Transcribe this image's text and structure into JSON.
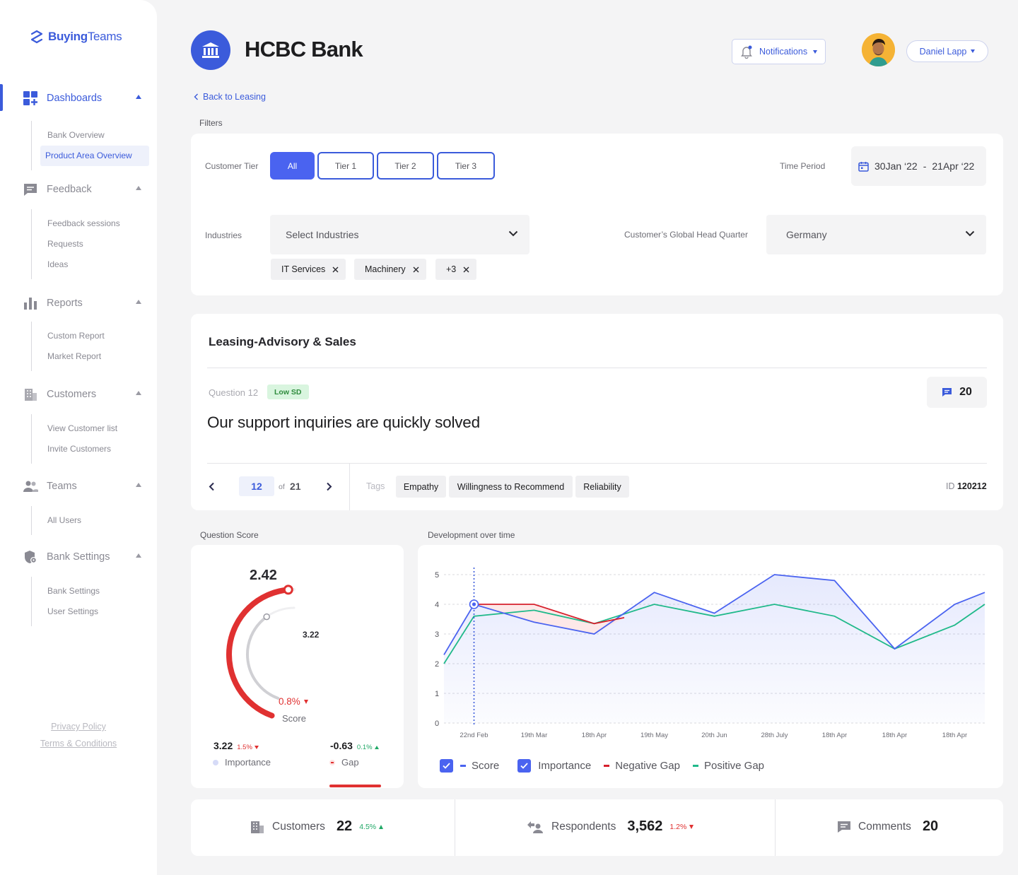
{
  "app": {
    "logo_bold": "Buying",
    "logo_light": "Teams"
  },
  "sidebar": {
    "groups": [
      {
        "label": "Dashboards",
        "icon": "dashboard-icon",
        "items": [
          "Bank Overview",
          "Product Area Overview"
        ],
        "selected": "Product Area Overview",
        "active": true
      },
      {
        "label": "Feedback",
        "icon": "feedback-icon",
        "items": [
          "Feedback sessions",
          "Requests",
          "Ideas"
        ]
      },
      {
        "label": "Reports",
        "icon": "bar-chart-icon",
        "items": [
          "Custom Report",
          "Market Report"
        ]
      },
      {
        "label": "Customers",
        "icon": "building-icon",
        "items": [
          "View Customer list",
          "Invite Customers"
        ]
      },
      {
        "label": "Teams",
        "icon": "people-icon",
        "items": [
          "All Users"
        ]
      },
      {
        "label": "Bank Settings",
        "icon": "shield-icon",
        "items": [
          "Bank Settings",
          "User Settings"
        ]
      }
    ],
    "footer": {
      "privacy": "Privacy Policy",
      "terms": "Terms & Conditions"
    }
  },
  "header": {
    "bank_name": "HCBC Bank",
    "notifications": "Notifications",
    "user": "Daniel Lapp"
  },
  "back_link": "Back to Leasing",
  "filters": {
    "section_label": "Filters",
    "customer_tier_label": "Customer Tier",
    "tiers": [
      "All",
      "Tier 1",
      "Tier 2",
      "Tier 3"
    ],
    "selected_tier": "All",
    "time_period_label": "Time Period",
    "time_start": "30Jan ‘22",
    "time_sep": "-",
    "time_end": "21Apr ‘22",
    "industries_label": "Industries",
    "industries_placeholder": "Select Industries",
    "industry_chips": [
      "IT Services",
      "Machinery",
      "+3"
    ],
    "hq_label": "Customer’s Global Head Quarter",
    "hq_value": "Germany"
  },
  "question_card": {
    "title": "Leasing-Advisory & Sales",
    "question_number": "Question 12",
    "badge": "Low SD",
    "question": "Our support inquiries are quickly solved",
    "comments": "20",
    "page_current": "12",
    "page_of": "of",
    "page_total": "21",
    "tags_label": "Tags",
    "tags": [
      "Empathy",
      "Willingness to Recommend",
      "Reliability"
    ],
    "id_label": "ID",
    "id_value": "120212"
  },
  "score_card": {
    "section_label": "Question Score",
    "score": "2.42",
    "inner": "3.22",
    "score_change": "0.8%",
    "score_label": "Score",
    "importance_value": "3.22",
    "importance_change": "1.5%",
    "importance_label": "Importance",
    "gap_value": "-0.63",
    "gap_change": "0.1%",
    "gap_label": "Gap",
    "score_fraction": 0.484,
    "importance_fraction": 0.644
  },
  "dev_section_label": "Development over time",
  "chart_data": {
    "type": "line",
    "categories": [
      "",
      "22nd Feb",
      "",
      "19th Mar",
      "",
      "18th Apr",
      "",
      "19th May",
      "",
      "20th Jun",
      "",
      "28th July",
      "",
      "18th Apr",
      "",
      "18th Apr",
      "",
      "18th Apr",
      ""
    ],
    "series": [
      {
        "name": "Score",
        "color": "#4a63f0",
        "values": [
          2.3,
          4.0,
          null,
          3.4,
          null,
          3.0,
          null,
          4.4,
          null,
          3.7,
          null,
          5.0,
          null,
          4.8,
          null,
          2.5,
          null,
          4.0,
          4.4
        ]
      },
      {
        "name": "Importance",
        "color": "#20b98a",
        "values": [
          2.0,
          3.6,
          null,
          3.8,
          null,
          3.35,
          null,
          4.0,
          null,
          3.6,
          null,
          4.0,
          null,
          3.6,
          null,
          2.5,
          null,
          3.3,
          4.0
        ]
      },
      {
        "name": "Negative Gap",
        "color": "#d6202c",
        "values": [
          null,
          null,
          null,
          4.0,
          null,
          3.35,
          null,
          null,
          null,
          null,
          null,
          null,
          null,
          null,
          null,
          null,
          null,
          null,
          null
        ]
      },
      {
        "name": "Positive Gap",
        "color": "#20b98a",
        "values": []
      }
    ],
    "ylim": [
      0,
      5
    ],
    "yticks": [
      "0",
      "1",
      "2",
      "3",
      "4",
      "5"
    ],
    "highlight_category": "22nd Feb",
    "grid": true,
    "legend": [
      "Score",
      "Importance",
      "Negative Gap",
      "Positive Gap"
    ]
  },
  "bottom_stats": {
    "customers_label": "Customers",
    "customers_value": "22",
    "customers_change": "4.5%",
    "respondents_label": "Respondents",
    "respondents_value": "3,562",
    "respondents_change": "1.2%",
    "comments_label": "Comments",
    "comments_value": "20"
  },
  "colors": {
    "accent": "#3b5bdb",
    "negative": "#e03131",
    "positive": "#20a866"
  }
}
